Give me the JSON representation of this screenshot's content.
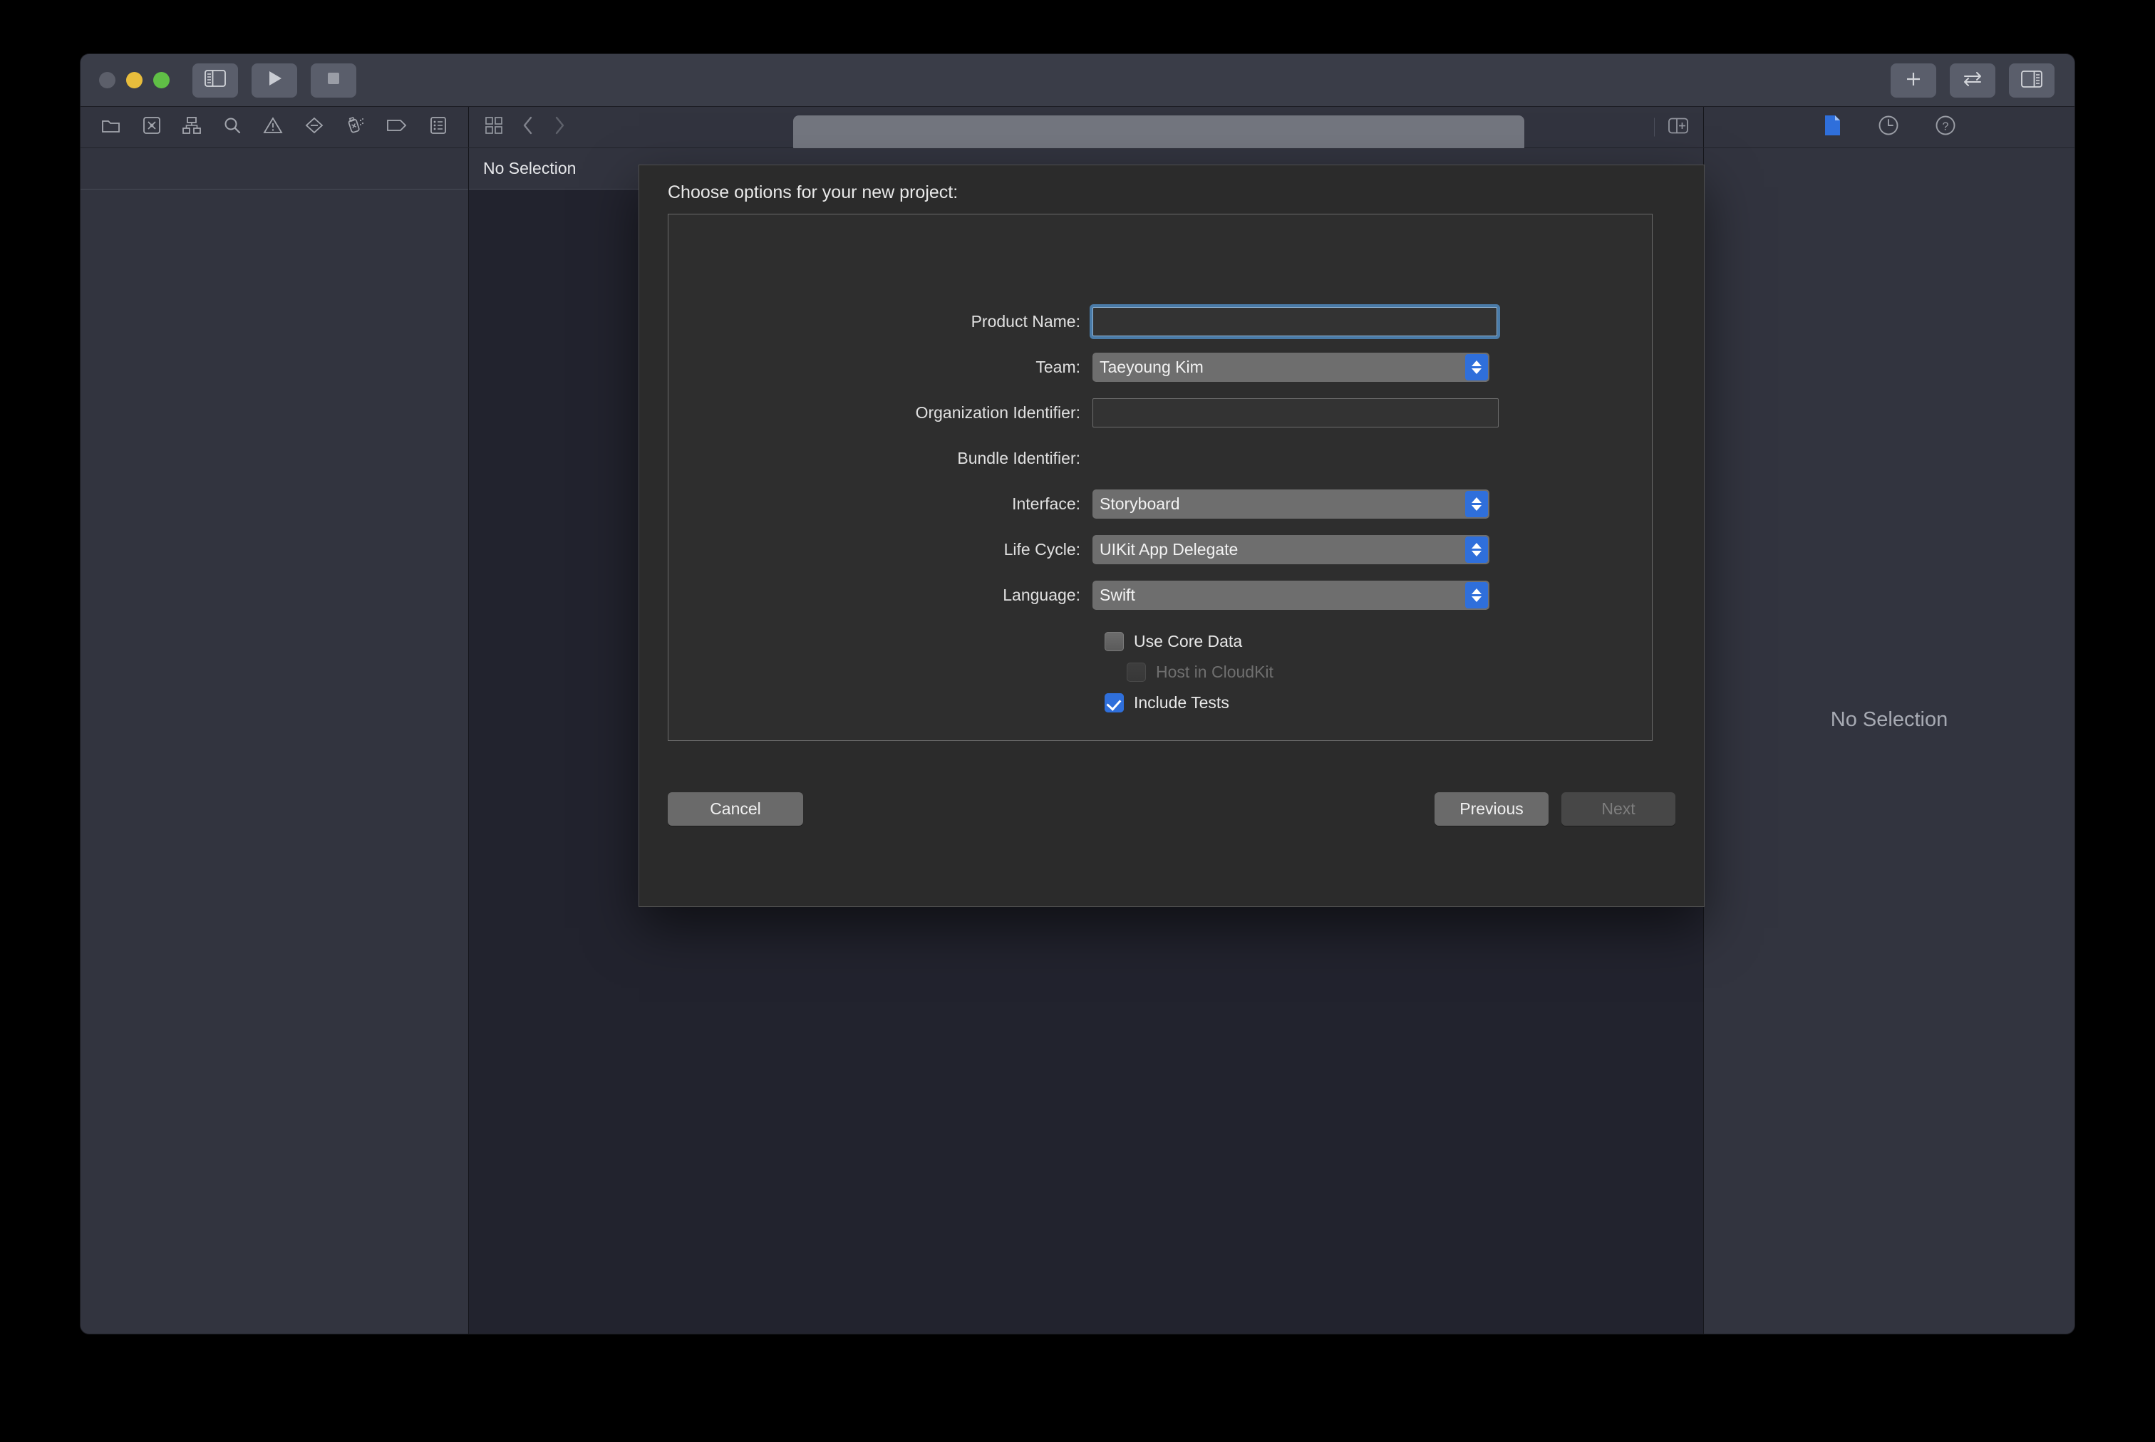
{
  "window": {
    "traffic_lights": [
      "close",
      "minimize",
      "maximize"
    ],
    "titlebar_buttons": {
      "navigator_toggle": "sidebar-left-icon",
      "run": "play-icon",
      "stop": "stop-icon",
      "add": "plus-icon",
      "swap": "swap-arrows-icon",
      "inspector_toggle": "sidebar-right-icon"
    },
    "activity_bar_text": ""
  },
  "navigator": {
    "icons": [
      {
        "name": "project-navigator-icon",
        "glyph": "folder"
      },
      {
        "name": "source-control-navigator-icon",
        "glyph": "x-box"
      },
      {
        "name": "symbol-navigator-icon",
        "glyph": "hierarchy"
      },
      {
        "name": "find-navigator-icon",
        "glyph": "search"
      },
      {
        "name": "issue-navigator-icon",
        "glyph": "warning"
      },
      {
        "name": "breakpoint-navigator-icon",
        "glyph": "diamond-minus"
      },
      {
        "name": "test-navigator-icon",
        "glyph": "spray"
      },
      {
        "name": "tag-navigator-icon",
        "glyph": "tag"
      },
      {
        "name": "report-navigator-icon",
        "glyph": "report-list"
      }
    ]
  },
  "editor": {
    "jump_icons": [
      {
        "name": "related-items-icon",
        "glyph": "grid"
      },
      {
        "name": "navigate-back-icon",
        "glyph": "chevron-left"
      },
      {
        "name": "navigate-forward-icon",
        "glyph": "chevron-right"
      }
    ],
    "add_editor_icon": "add-editor-icon",
    "jumpbar_text": "No Selection"
  },
  "inspector": {
    "icons": [
      {
        "name": "file-inspector-icon",
        "glyph": "file",
        "active": true
      },
      {
        "name": "history-inspector-icon",
        "glyph": "clock",
        "active": false
      },
      {
        "name": "quick-help-inspector-icon",
        "glyph": "question",
        "active": false
      }
    ],
    "empty_state": "No Selection"
  },
  "sheet": {
    "title": "Choose options for your new project:",
    "fields": [
      {
        "label": "Product Name:",
        "control": "text",
        "value": "",
        "placeholder": "",
        "focused": true,
        "name": "product-name"
      },
      {
        "label": "Team:",
        "control": "popup",
        "value": "Taeyoung Kim",
        "name": "team"
      },
      {
        "label": "Organization Identifier:",
        "control": "text",
        "value": "",
        "placeholder": "",
        "focused": false,
        "name": "organization-identifier"
      },
      {
        "label": "Bundle Identifier:",
        "control": "static",
        "value": "",
        "name": "bundle-identifier"
      },
      {
        "label": "Interface:",
        "control": "popup",
        "value": "Storyboard",
        "name": "interface"
      },
      {
        "label": "Life Cycle:",
        "control": "popup",
        "value": "UIKit App Delegate",
        "name": "life-cycle"
      },
      {
        "label": "Language:",
        "control": "popup",
        "value": "Swift",
        "name": "language"
      }
    ],
    "checkboxes": [
      {
        "label": "Use Core Data",
        "checked": false,
        "disabled": false,
        "indented": false,
        "name": "use-core-data"
      },
      {
        "label": "Host in CloudKit",
        "checked": false,
        "disabled": true,
        "indented": true,
        "name": "host-in-cloudkit"
      },
      {
        "label": "Include Tests",
        "checked": true,
        "disabled": false,
        "indented": false,
        "name": "include-tests"
      }
    ],
    "buttons": {
      "cancel": "Cancel",
      "previous": "Previous",
      "next": "Next",
      "next_disabled": true
    }
  },
  "colors": {
    "accent_blue": "#2f6fdb",
    "focus_ring": "#4a7ba8",
    "window_chrome": "#3a3d48",
    "panel_bg": "#32343f",
    "editor_bg": "#22232e",
    "sheet_bg": "#2b2b2b",
    "traffic_yellow": "#e8bd3c",
    "traffic_green": "#60bf46",
    "traffic_gray": "#5c5f6a"
  }
}
